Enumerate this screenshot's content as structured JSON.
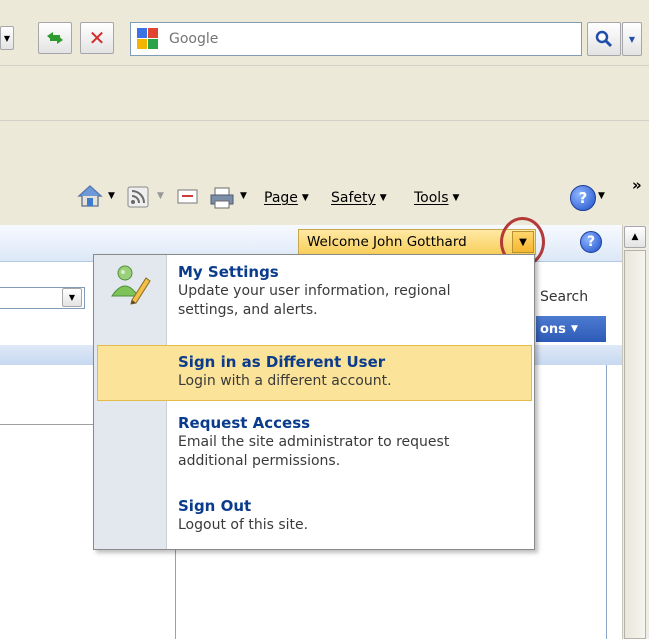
{
  "browser": {
    "search_placeholder": "Google",
    "command_bar": {
      "page": "Page",
      "safety": "Safety",
      "tools": "Tools",
      "more": "»"
    }
  },
  "sharepoint": {
    "welcome": "Welcome John Gotthard",
    "search_label": "Search",
    "actions_label": "ons",
    "menu": [
      {
        "title": "My Settings",
        "description": "Update your user information, regional settings, and alerts."
      },
      {
        "title": "Sign in as Different User",
        "description": "Login with a different account."
      },
      {
        "title": "Request Access",
        "description": "Email the site administrator to request additional permissions."
      },
      {
        "title": "Sign Out",
        "description": "Logout of this site."
      }
    ]
  },
  "colors": {
    "menu_hover": "#fbe39a",
    "link_blue": "#0a3b8c",
    "highlight_ring": "#b43a3a"
  }
}
